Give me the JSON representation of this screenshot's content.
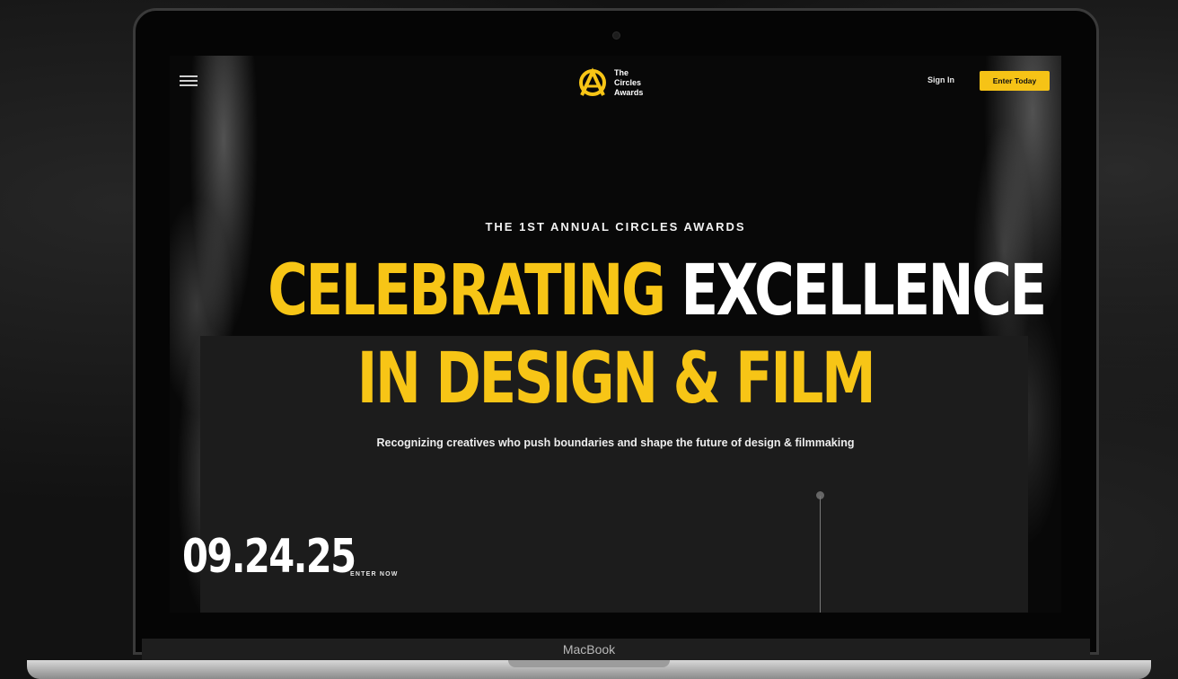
{
  "device": {
    "brand_label": "MacBook"
  },
  "nav": {
    "menu_icon": "hamburger-menu-icon",
    "logo_lines": [
      "The",
      "Circles",
      "Awards"
    ],
    "sign_in": "Sign In",
    "cta": "Enter Today"
  },
  "hero": {
    "kicker": "THE 1ST ANNUAL CIRCLES AWARDS",
    "headline_yellow_1": "CELEBRATING",
    "headline_white_1": "EXCELLENCE",
    "headline_line_2": "IN DESIGN & FILM",
    "tagline": "Recognizing creatives who push boundaries and shape the future of design & filmmaking",
    "date": "09.24.25",
    "enter_now": "ENTER NOW"
  },
  "colors": {
    "accent": "#f7c516",
    "background": "#080808",
    "panel": "#1c1c1c"
  }
}
